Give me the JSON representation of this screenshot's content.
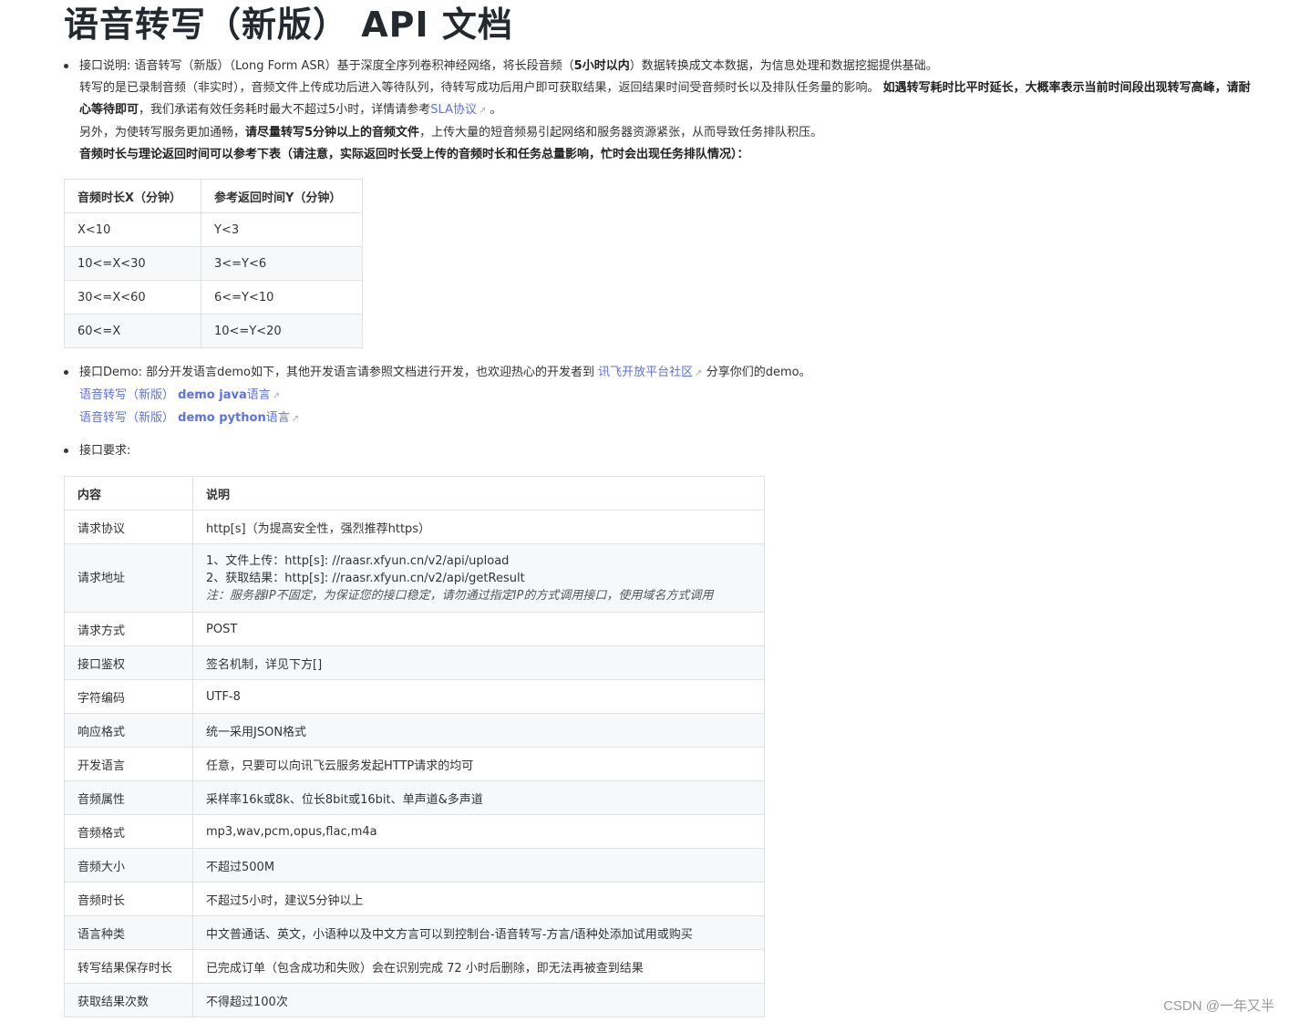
{
  "doc": {
    "title": "语音转写（新版） API 文档",
    "intro": {
      "lead_label": "接口说明: ",
      "lead_text_a": "语音转写（新版）（Long Form ASR）基于深度全序列卷积神经网络，将长段音频（",
      "lead_bold": "5小时以内",
      "lead_text_b": "）数据转换成文本数据，为信息处理和数据挖掘提供基础。",
      "line2_a": "转写的是已录制音频（非实时），音频文件上传成功后进入等待队列，待转写成功后用户即可获取结果，返回结果时间受音频时长以及排队任务量的影响。",
      "line2_bold": "如遇转写耗时比平时延长，大概率表示当前时间段出现转写高峰，请耐心等待即可",
      "line2_b": "，我们承诺有效任务耗时最大不超过5小时，详情请参考",
      "line2_link": "SLA协议",
      "line2_end": "。",
      "line3_a": "另外，为使转写服务更加通畅，",
      "line3_bold": "请尽量转写5分钟以上的音频文件",
      "line3_b": "，上传大量的短音频易引起网络和服务器资源紧张，从而导致任务排队积压。",
      "line4_bold": "音频时长与理论返回时间可以参考下表（请注意，实际返回时长受上传的音频时长和任务总量影响，忙时会出现任务排队情况）："
    },
    "time_table": {
      "headers": [
        "音频时长X（分钟）",
        "参考返回时间Y（分钟）"
      ],
      "rows": [
        [
          "X<10",
          "Y<3"
        ],
        [
          "10<=X<30",
          "3<=Y<6"
        ],
        [
          "30<=X<60",
          "6<=Y<10"
        ],
        [
          "60<=X",
          "10<=Y<20"
        ]
      ]
    },
    "demo": {
      "label": "接口Demo: ",
      "text_a": "部分开发语言demo如下，其他开发语言请参照文档进行开发，也欢迎热心的开发者到",
      "community_link": "讯飞开放平台社区",
      "text_b": "分享你们的demo。",
      "java_prefix": "语音转写（新版） ",
      "java_bold": "demo java",
      "java_suffix": "语言",
      "python_prefix": "语音转写（新版） ",
      "python_bold": "demo python",
      "python_suffix": "语言"
    },
    "requirements_label": "接口要求:",
    "req_table": {
      "headers": [
        "内容",
        "说明"
      ],
      "rows": [
        {
          "k": "请求协议",
          "v": "http[s]（为提高安全性，强烈推荐https）"
        },
        {
          "k": "请求地址",
          "v1": "1、文件上传：http[s]: //raasr.xfyun.cn/v2/api/upload",
          "v2": "2、获取结果：http[s]: //raasr.xfyun.cn/v2/api/getResult",
          "v3": "注：服务器IP不固定，为保证您的接口稳定，请勿通过指定IP的方式调用接口，使用域名方式调用"
        },
        {
          "k": "请求方式",
          "v": "POST"
        },
        {
          "k": "接口鉴权",
          "v": "签名机制，详见下方[]"
        },
        {
          "k": "字符编码",
          "v": "UTF-8"
        },
        {
          "k": "响应格式",
          "v": "统一采用JSON格式"
        },
        {
          "k": "开发语言",
          "v": "任意，只要可以向讯飞云服务发起HTTP请求的均可"
        },
        {
          "k": "音频属性",
          "v": "采样率16k或8k、位长8bit或16bit、单声道&多声道"
        },
        {
          "k": "音频格式",
          "v": "mp3,wav,pcm,opus,flac,m4a"
        },
        {
          "k": "音频大小",
          "v": "不超过500M"
        },
        {
          "k": "音频时长",
          "v": "不超过5小时，建议5分钟以上"
        },
        {
          "k": "语言种类",
          "v": "中文普通话、英文，小语种以及中文方言可以到控制台-语音转写-方言/语种处添加试用或购买"
        },
        {
          "k": "转写结果保存时长",
          "v": "已完成订单（包含成功和失败）会在识别完成 72 小时后删除，即无法再被查到结果"
        },
        {
          "k": "获取结果次数",
          "v": "不得超过100次"
        }
      ]
    },
    "watermark": "CSDN @一年又半",
    "colors": {
      "link": "#5b71e8",
      "title": "#24292f",
      "stripe": "#f6f8fa",
      "border": "#dfe2e5"
    }
  }
}
